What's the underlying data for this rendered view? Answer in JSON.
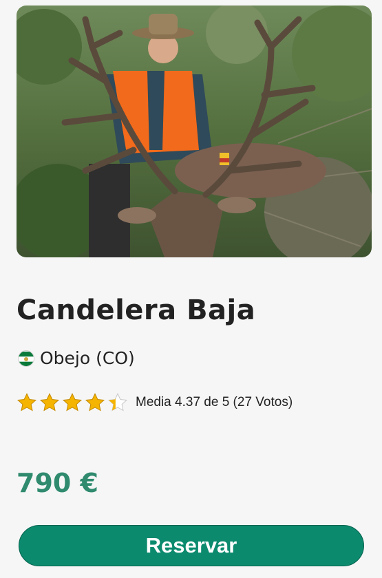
{
  "listing": {
    "title": "Candelera Baja",
    "location": "Obejo (CO)",
    "region_flag_icon": "andalusia-flag-icon",
    "rating": {
      "value": 4.37,
      "max": 5,
      "votes": 27,
      "text": "Media 4.37 de 5 (27 Votos)",
      "star_icons": [
        "star-full-icon",
        "star-full-icon",
        "star-full-icon",
        "star-full-icon",
        "star-partial-icon"
      ]
    },
    "price": "790 €",
    "reserve_label": "Reservar",
    "photo_icon": "hunter-with-deer-photo"
  },
  "colors": {
    "accent": "#0b8a6e",
    "price": "#2f8a6e",
    "star": "#f5b400"
  }
}
